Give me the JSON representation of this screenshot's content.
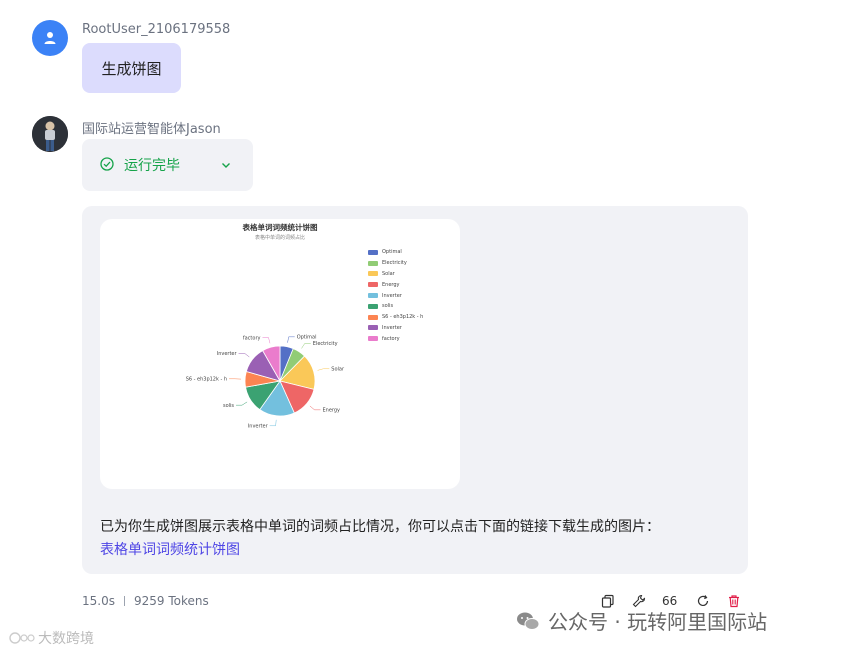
{
  "user": {
    "name": "RootUser_2106179558",
    "message": "生成饼图"
  },
  "bot": {
    "name": "国际站运营智能体Jason",
    "status": "运行完毕",
    "reply_text": "已为你生成饼图展示表格中单词的词频占比情况，你可以点击下面的链接下载生成的图片：",
    "link_text": "表格单词词频统计饼图"
  },
  "chart_data": {
    "type": "pie",
    "title": "表格单词词频统计饼图",
    "subtitle": "表格中单词的词频占比",
    "legend_position": "top-right",
    "categories": [
      "Optimal",
      "Electricity",
      "Solar",
      "Energy",
      "Inverter",
      "solis",
      "S6 - eh3p12k - h",
      "Inverter",
      "factory"
    ],
    "values": [
      6,
      6,
      16,
      14,
      16,
      12,
      7,
      12,
      8
    ],
    "colors": [
      "#5470c6",
      "#91cc75",
      "#fac858",
      "#ee6666",
      "#73c0de",
      "#3ba272",
      "#fc8452",
      "#9a60b4",
      "#ea7ccc"
    ]
  },
  "meta": {
    "duration": "15.0s",
    "tokens": "9259 Tokens",
    "quote_count": "66"
  },
  "watermark": {
    "text": "公众号 · 玩转阿里国际站",
    "left_text": "大数跨境"
  }
}
